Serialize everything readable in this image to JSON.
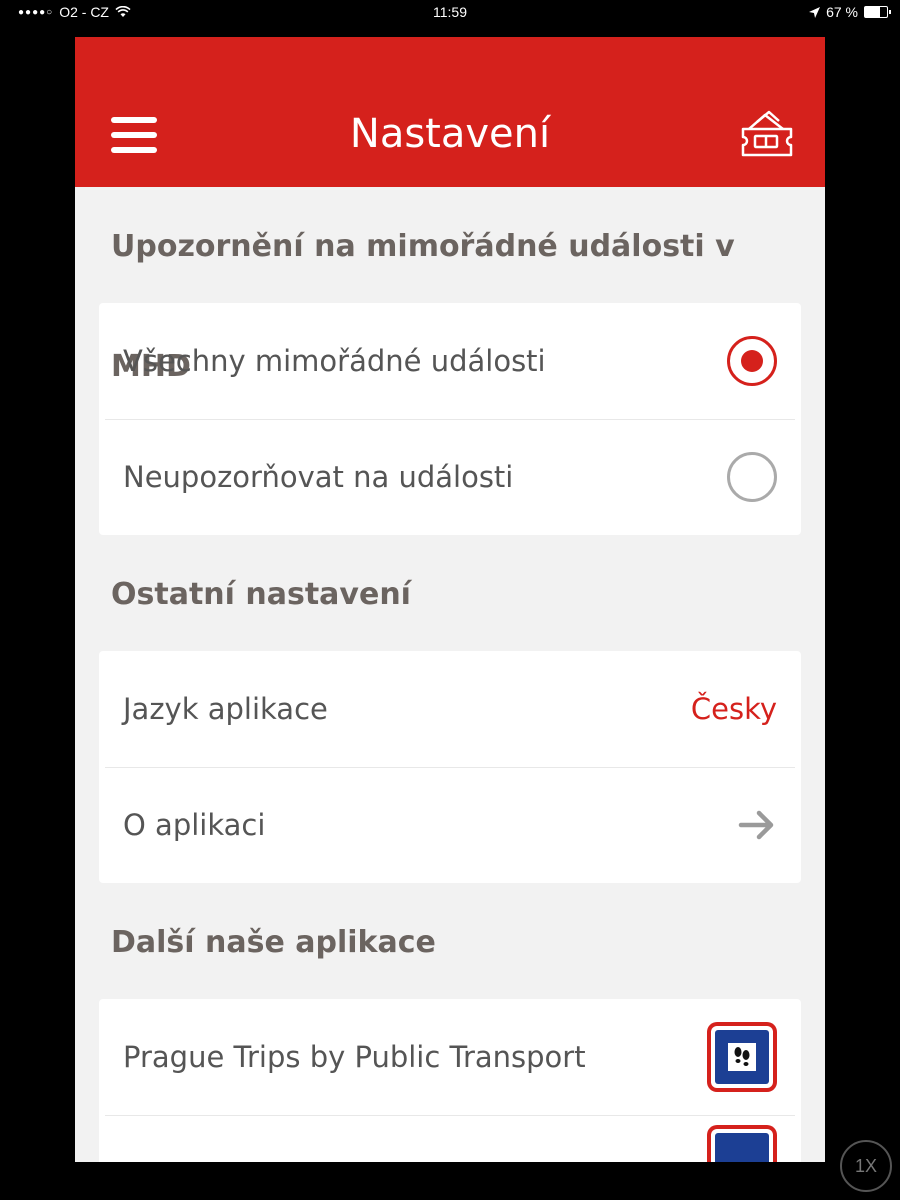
{
  "status_bar": {
    "signal_dots": "●●●●○",
    "carrier": "O2 - CZ",
    "time": "11:59",
    "battery_percent": "67 %",
    "battery_level": 0.67
  },
  "app_bar": {
    "title": "Nastavení",
    "menu_icon": "hamburger-menu-icon",
    "ticket_icon": "ticket-icon"
  },
  "sections": [
    {
      "title": "Upozornění na mimořádné události v MHD",
      "rows": [
        {
          "label": "Všechny mimořádné události",
          "selected": true
        },
        {
          "label": "Neupozorňovat na události",
          "selected": false
        }
      ]
    },
    {
      "title": "Ostatní nastavení",
      "rows": [
        {
          "label": "Jazyk aplikace",
          "value": "Česky"
        },
        {
          "label": "O aplikaci",
          "icon": "arrow-right-icon"
        }
      ]
    },
    {
      "title": "Další naše aplikace",
      "rows": [
        {
          "label": "Prague Trips by Public Transport",
          "icon": "prague-trips-app-icon"
        }
      ]
    }
  ],
  "zoom_indicator": "1X",
  "colors": {
    "accent": "#d5211c",
    "background": "#f2f2f2",
    "section_title": "#6b6460"
  }
}
